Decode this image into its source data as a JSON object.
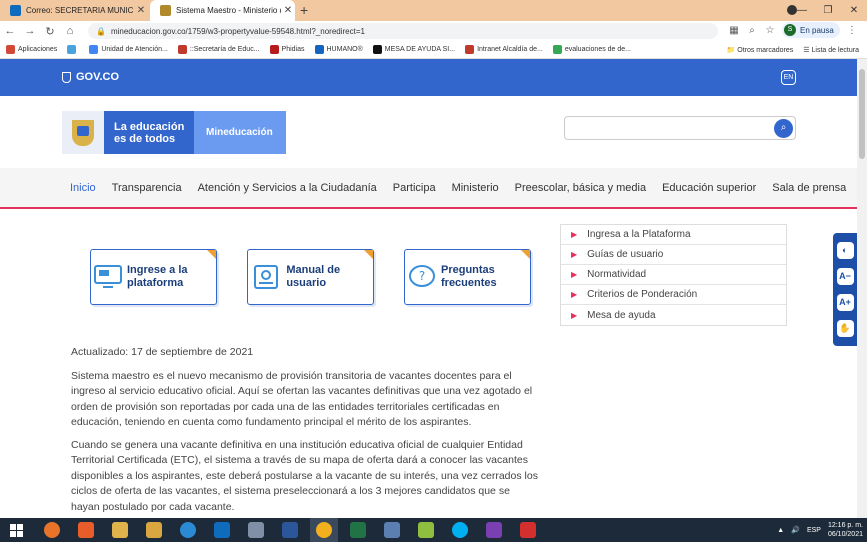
{
  "browser": {
    "tabs": [
      {
        "title": "Correo: SECRETARIA MUNICIPAL",
        "color": "#0f6cbd"
      },
      {
        "title": "Sistema Maestro - Ministerio de",
        "color": "#b08a2a"
      }
    ],
    "new_tab": "+",
    "url": "mineducacion.gov.co/1759/w3-propertyvalue-59548.html?_noredirect=1",
    "profile_status": "En pausa",
    "profile_initial": "S",
    "bookmarks": [
      {
        "label": "Aplicaciones",
        "color": "#d14836"
      },
      {
        "label": "",
        "color": "#4aa3df"
      },
      {
        "label": "Unidad de Atención...",
        "color": "#4285f4"
      },
      {
        "label": "::Secretaría de Educ...",
        "color": "#c0392b"
      },
      {
        "label": "Phidias",
        "color": "#b71c1c"
      },
      {
        "label": "HUMANO®",
        "color": "#1565c0"
      },
      {
        "label": "MESA DE AYUDA SI...",
        "color": "#111111"
      },
      {
        "label": "Intranet Alcaldía de...",
        "color": "#c0392b"
      },
      {
        "label": "evaluaciones de de...",
        "color": "#34a853"
      }
    ],
    "bookmarks_right": [
      "Otros marcadores",
      "Lista de lectura"
    ]
  },
  "gov": {
    "logo": "GOV.CO",
    "lang": "EN"
  },
  "header": {
    "slogan": "La educación es de todos",
    "brand": "Mineducación",
    "search_placeholder": ""
  },
  "nav": [
    "Inicio",
    "Transparencia",
    "Atención y Servicios a la Ciudadanía",
    "Participa",
    "Ministerio",
    "Preescolar, básica y media",
    "Educación superior",
    "Sala de prensa"
  ],
  "cards": [
    {
      "label": "Ingrese a la plataforma"
    },
    {
      "label": "Manual de usuario"
    },
    {
      "label": "Preguntas frecuentes"
    }
  ],
  "side_menu": [
    "Ingresa a la Plataforma",
    "Guías de usuario",
    "Normatividad",
    "Criterios de Ponderación",
    "Mesa de ayuda"
  ],
  "accessibility": [
    "◐",
    "A−",
    "A+",
    "✋"
  ],
  "content": {
    "updated": "Actualizado: 17 de septiembre de 2021",
    "p1": "Sistema maestro es el nuevo mecanismo de provisión transitoria de vacantes docentes para el ingreso al servicio educativo oficial. Aquí se ofertan las vacantes definitivas que una vez agotado el orden de provisión son reportadas por cada una de las entidades territoriales certificadas en educación, teniendo en cuenta como fundamento principal el mérito de los aspirantes.",
    "p2": "Cuando se genera una vacante definitiva en una institución educativa oficial de cualquier Entidad Territorial Certificada (ETC), el sistema a través de su mapa de oferta dará a conocer las vacantes disponibles a los aspirantes, este deberá postularse a la vacante de su interés, una vez cerrados los ciclos de oferta de las vacantes, el sistema preseleccionará a los 3 mejores candidatos que se hayan postulado por cada vacante."
  },
  "taskbar": {
    "apps": [
      {
        "name": "firefox",
        "color": "#e8742a"
      },
      {
        "name": "media",
        "color": "#e85d2a"
      },
      {
        "name": "folder1",
        "color": "#e0b44a"
      },
      {
        "name": "folder2",
        "color": "#d9a640"
      },
      {
        "name": "ie",
        "color": "#2a8ad4"
      },
      {
        "name": "outlook",
        "color": "#0f6cbd"
      },
      {
        "name": "doc",
        "color": "#7f8fa6"
      },
      {
        "name": "word",
        "color": "#2b579a"
      },
      {
        "name": "chrome",
        "color": "#f2b01e"
      },
      {
        "name": "excel",
        "color": "#217346"
      },
      {
        "name": "network",
        "color": "#5a7fb0"
      },
      {
        "name": "tool",
        "color": "#8fbf3f"
      },
      {
        "name": "skype",
        "color": "#00aff0"
      },
      {
        "name": "search",
        "color": "#7a3fb0"
      },
      {
        "name": "pdf",
        "color": "#d32f2f"
      }
    ],
    "lang": "ESP",
    "time": "12:16 p. m.",
    "date": "06/10/2021"
  }
}
